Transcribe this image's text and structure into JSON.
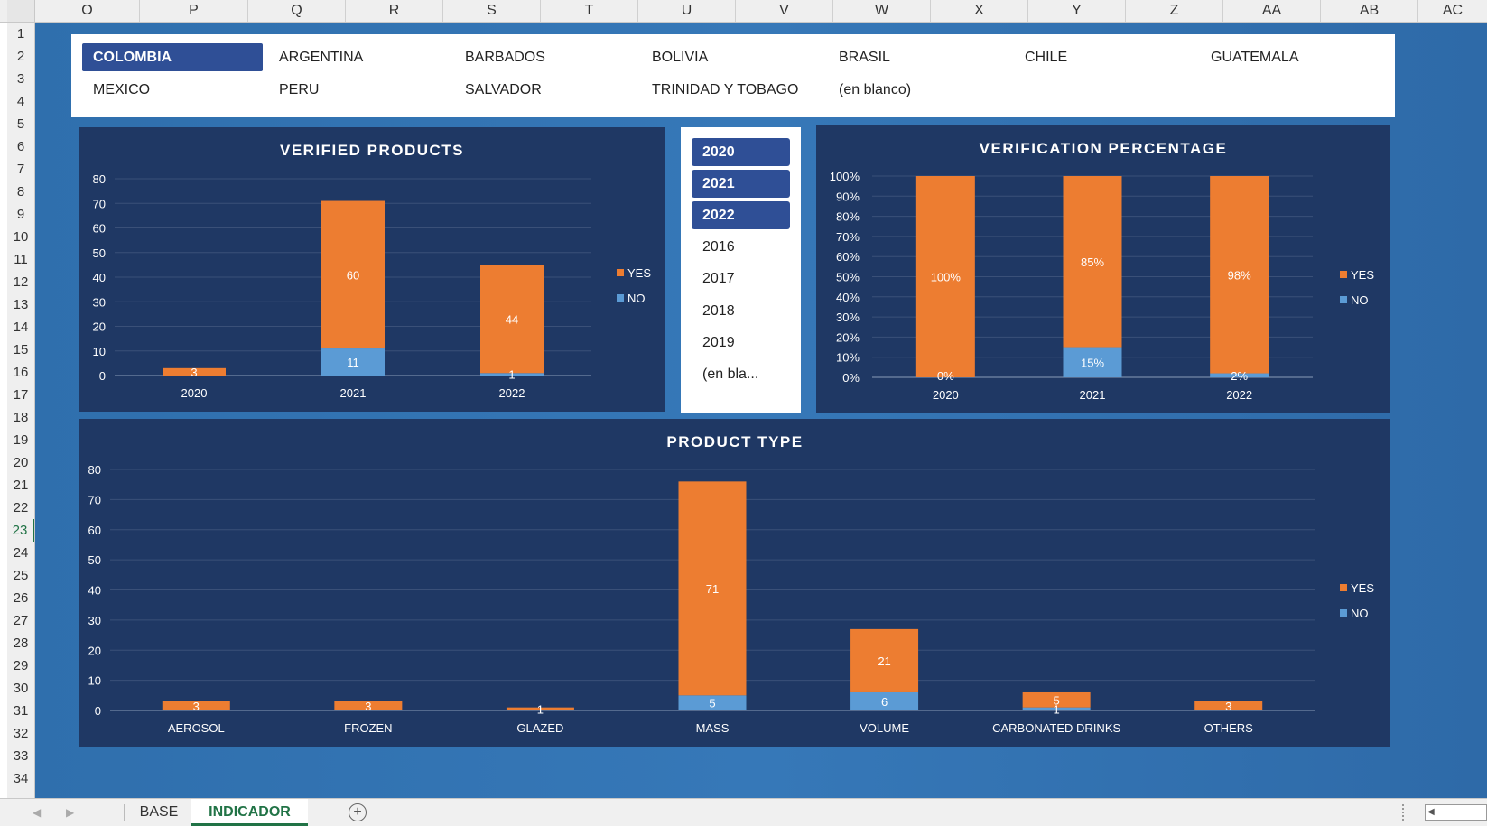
{
  "columns": [
    "O",
    "P",
    "Q",
    "R",
    "S",
    "T",
    "U",
    "V",
    "W",
    "X",
    "Y",
    "Z",
    "AA",
    "AB",
    "AC"
  ],
  "rows": [
    "1",
    "2",
    "3",
    "4",
    "5",
    "6",
    "7",
    "8",
    "9",
    "10",
    "11",
    "12",
    "13",
    "14",
    "15",
    "16",
    "17",
    "18",
    "19",
    "20",
    "21",
    "22",
    "23",
    "24",
    "25",
    "26",
    "27",
    "28",
    "29",
    "30",
    "31",
    "32",
    "33",
    "34"
  ],
  "selected_row": "23",
  "country_slicer": {
    "items": [
      {
        "label": "COLOMBIA",
        "active": true
      },
      {
        "label": "ARGENTINA",
        "active": false
      },
      {
        "label": "BARBADOS",
        "active": false
      },
      {
        "label": "BOLIVIA",
        "active": false
      },
      {
        "label": "BRASIL",
        "active": false
      },
      {
        "label": "CHILE",
        "active": false
      },
      {
        "label": "GUATEMALA",
        "active": false
      },
      {
        "label": "MEXICO",
        "active": false
      },
      {
        "label": "PERU",
        "active": false
      },
      {
        "label": "SALVADOR",
        "active": false
      },
      {
        "label": "TRINIDAD Y TOBAGO",
        "active": false
      },
      {
        "label": "(en blanco)",
        "active": false
      }
    ]
  },
  "year_slicer": {
    "items": [
      {
        "label": "2020",
        "active": true
      },
      {
        "label": "2021",
        "active": true
      },
      {
        "label": "2022",
        "active": true
      },
      {
        "label": "2016",
        "active": false
      },
      {
        "label": "2017",
        "active": false
      },
      {
        "label": "2018",
        "active": false
      },
      {
        "label": "2019",
        "active": false
      },
      {
        "label": "(en bla...",
        "active": false
      }
    ]
  },
  "colors": {
    "yes": "#ed7d31",
    "no": "#5b9bd5",
    "panel": "#1f3864",
    "grid": "#3a5078",
    "axis_text": "#ffffff"
  },
  "legend": {
    "yes": "YES",
    "no": "NO"
  },
  "chart_data": [
    {
      "type": "bar",
      "stacked": true,
      "title": "VERIFIED PRODUCTS",
      "categories": [
        "2020",
        "2021",
        "2022"
      ],
      "series": [
        {
          "name": "NO",
          "values": [
            0,
            11,
            1
          ],
          "labels": [
            "",
            "11",
            "1"
          ]
        },
        {
          "name": "YES",
          "values": [
            3,
            60,
            44
          ],
          "labels": [
            "3",
            "60",
            "44"
          ]
        }
      ],
      "ylim": [
        0,
        80
      ],
      "yticks": [
        "0",
        "10",
        "20",
        "30",
        "40",
        "50",
        "60",
        "70",
        "80"
      ],
      "grid": true,
      "legend_position": "right"
    },
    {
      "type": "bar",
      "stacked": true,
      "title": "VERIFICATION PERCENTAGE",
      "categories": [
        "2020",
        "2021",
        "2022"
      ],
      "series": [
        {
          "name": "NO",
          "values": [
            0,
            15,
            2
          ],
          "labels": [
            "0%",
            "15%",
            "2%"
          ]
        },
        {
          "name": "YES",
          "values": [
            100,
            85,
            98
          ],
          "labels": [
            "100%",
            "85%",
            "98%"
          ]
        }
      ],
      "ylim": [
        0,
        100
      ],
      "yticks": [
        "0%",
        "10%",
        "20%",
        "30%",
        "40%",
        "50%",
        "60%",
        "70%",
        "80%",
        "90%",
        "100%"
      ],
      "grid": true,
      "legend_position": "right"
    },
    {
      "type": "bar",
      "stacked": true,
      "title": "PRODUCT TYPE",
      "categories": [
        "AEROSOL",
        "FROZEN",
        "GLAZED",
        "MASS",
        "VOLUME",
        "CARBONATED DRINKS",
        "OTHERS"
      ],
      "series": [
        {
          "name": "NO",
          "values": [
            0,
            0,
            0,
            5,
            6,
            1,
            0
          ],
          "labels": [
            "",
            "",
            "",
            "5",
            "6",
            "1",
            ""
          ]
        },
        {
          "name": "YES",
          "values": [
            3,
            3,
            1,
            71,
            21,
            5,
            3
          ],
          "labels": [
            "3",
            "3",
            "1",
            "71",
            "21",
            "5",
            "3"
          ]
        }
      ],
      "ylim": [
        0,
        80
      ],
      "yticks": [
        "0",
        "10",
        "20",
        "30",
        "40",
        "50",
        "60",
        "70",
        "80"
      ],
      "grid": true,
      "legend_position": "right"
    }
  ],
  "tabs": [
    {
      "label": "BASE",
      "active": false
    },
    {
      "label": "INDICADOR",
      "active": true
    }
  ]
}
